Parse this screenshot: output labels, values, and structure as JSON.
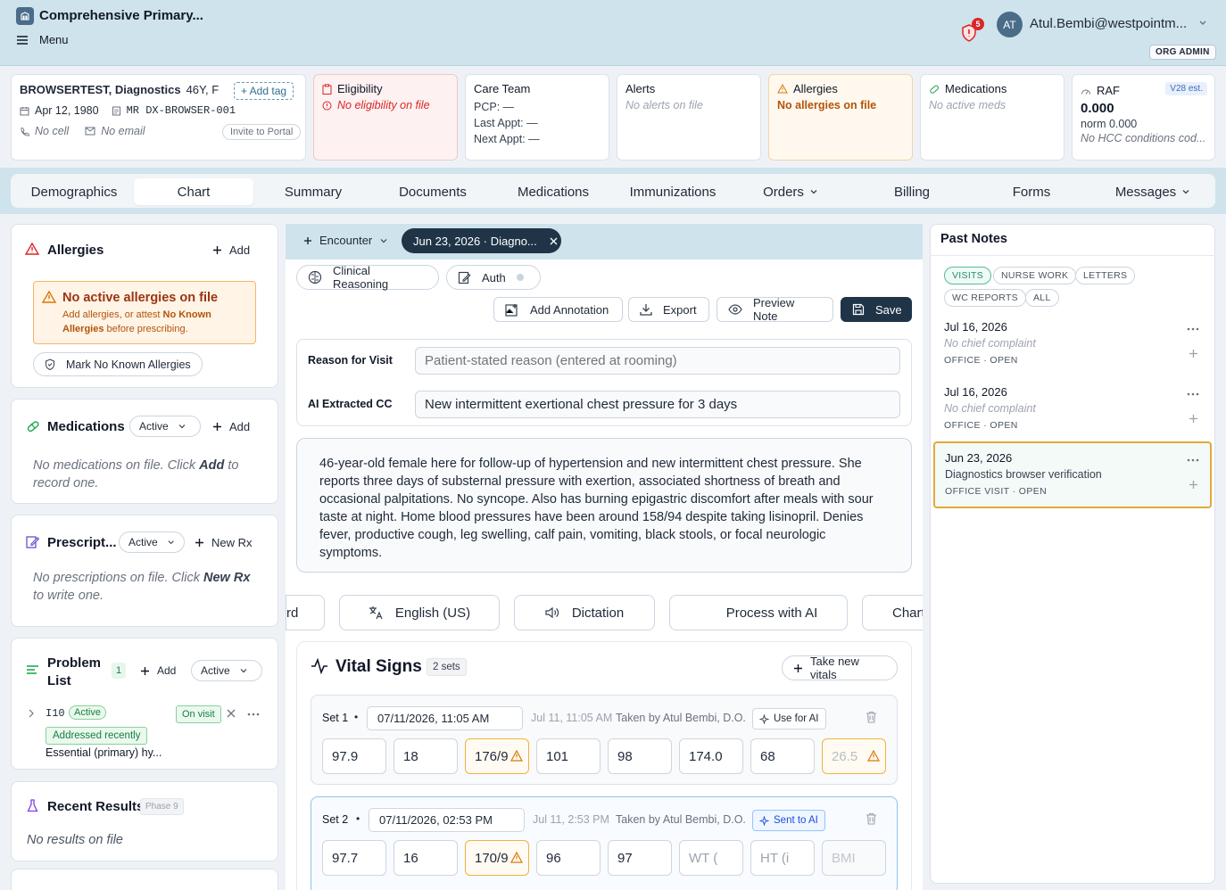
{
  "app": {
    "title": "Comprehensive Primary...",
    "menu": "Menu",
    "notifications": "5",
    "avatar": "AT",
    "user_email": "Atul.Bembi@westpointm...",
    "role": "ORG ADMIN"
  },
  "patient": {
    "name": "BROWSERTEST, Diagnostics",
    "age_sex": "46Y, F",
    "add_tag": "+ Add tag",
    "dob": "Apr 12, 1980",
    "mrn": "MR DX-BROWSER-001",
    "phone": "No cell",
    "email": "No email",
    "invite": "Invite to Portal"
  },
  "eligibility": {
    "title": "Eligibility",
    "status": "No eligibility on file"
  },
  "care_team": {
    "title": "Care Team",
    "pcp": "PCP: —",
    "last": "Last Appt: —",
    "next": "Next Appt: —"
  },
  "alerts": {
    "title": "Alerts",
    "status": "No alerts on file"
  },
  "allergies_card": {
    "title": "Allergies",
    "status": "No allergies on file"
  },
  "meds_card": {
    "title": "Medications",
    "status": "No active meds"
  },
  "raf": {
    "title": "RAF",
    "badge": "V28 est.",
    "score": "0.000",
    "norm": "norm 0.000",
    "status": "No HCC conditions cod..."
  },
  "tabs": [
    "Demographics",
    "Chart",
    "Summary",
    "Documents",
    "Medications",
    "Immunizations",
    "Orders",
    "Billing",
    "Forms",
    "Messages"
  ],
  "left": {
    "allergies": {
      "title": "Allergies",
      "add": "Add",
      "warn_title": "No active allergies on file",
      "warn_pre": "Add allergies, or attest ",
      "warn_bold": "No Known Allergies",
      "warn_post": " before prescribing.",
      "nka_btn": "Mark No Known Allergies"
    },
    "medications": {
      "title": "Medications",
      "filter": "Active",
      "add": "Add",
      "empty_pre": "No medications on file. Click ",
      "empty_bold": "Add",
      "empty_post": " to record one."
    },
    "prescriptions": {
      "title": "Prescript...",
      "filter": "Active",
      "add": "New Rx",
      "empty_pre": "No prescriptions on file. Click ",
      "empty_bold": "New Rx",
      "empty_post": " to write one."
    },
    "problems": {
      "title1": "Problem",
      "title2": "List",
      "count": "1",
      "add": "Add",
      "filter": "Active",
      "code": "I10",
      "status": "Active",
      "on_visit": "On visit",
      "recent": "Addressed recently",
      "desc": "Essential (primary) hy..."
    },
    "results": {
      "title": "Recent Results",
      "badge": "Phase 9",
      "empty": "No results on file"
    }
  },
  "encounter": {
    "menu": "Encounter",
    "active_tab": "Jun 23, 2026 · Diagno...",
    "clinical_reasoning": "Clinical Reasoning",
    "auth": "Auth",
    "add_annotation": "Add Annotation",
    "export": "Export",
    "preview": "Preview Note",
    "save": "Save",
    "reason_label": "Reason for Visit",
    "reason_placeholder": "Patient-stated reason (entered at rooming)",
    "cc_label": "AI Extracted CC",
    "cc_value": "New intermittent exertional chest pressure for 3 days",
    "narrative": "46-year-old female here for follow-up of hypertension and new intermittent chest pressure. She reports three days of substernal pressure with exertion, associated shortness of breath and occasional palpitations. No syncope. Also has burning epigastric discomfort after meals with sour taste at night. Home blood pressures have been around 158/94 despite taking lisinopril. Denies fever, productive cough, leg swelling, calf pain, vomiting, black stools, or focal neurologic symptoms.",
    "record_btn": "rd",
    "language": "English (US)",
    "dictation": "Dictation",
    "process": "Process with AI",
    "chart_btn": "Chart"
  },
  "vitals": {
    "title": "Vital Signs",
    "sets_badge": "2 sets",
    "take_new": "Take new vitals",
    "set1": {
      "label": "Set 1",
      "datetime": "07/11/2026, 11:05 AM",
      "stamp": "Jul 11, 11:05 AM",
      "taken_by": "Taken by Atul Bembi, D.O.",
      "ai": "Use for AI",
      "values": [
        "97.9",
        "18",
        "176/9",
        "101",
        "98",
        "174.0",
        "68",
        "26.5"
      ]
    },
    "set2": {
      "label": "Set 2",
      "datetime": "07/11/2026, 02:53 PM",
      "stamp": "Jul 11, 2:53 PM",
      "taken_by": "Taken by Atul Bembi, D.O.",
      "ai": "Sent to AI",
      "values": [
        "97.7",
        "16",
        "170/9",
        "96",
        "97"
      ],
      "placeholders": [
        "WT (",
        "HT (i",
        "BMI"
      ]
    }
  },
  "past_notes": {
    "title": "Past Notes",
    "chips": [
      "VISITS",
      "NURSE WORK",
      "LETTERS",
      "WC REPORTS",
      "ALL"
    ],
    "notes": [
      {
        "date": "Jul 16, 2026",
        "cc": "No chief complaint",
        "meta": "OFFICE · OPEN"
      },
      {
        "date": "Jul 16, 2026",
        "cc": "No chief complaint",
        "meta": "OFFICE · OPEN"
      },
      {
        "date": "Jun 23, 2026",
        "cc": "Diagnostics browser verification",
        "meta": "OFFICE VISIT · OPEN"
      }
    ]
  },
  "colors": {
    "accent": "#1f3447",
    "warning": "#f0b340",
    "danger": "#dc2626",
    "header_bg": "#cfe3ec"
  }
}
